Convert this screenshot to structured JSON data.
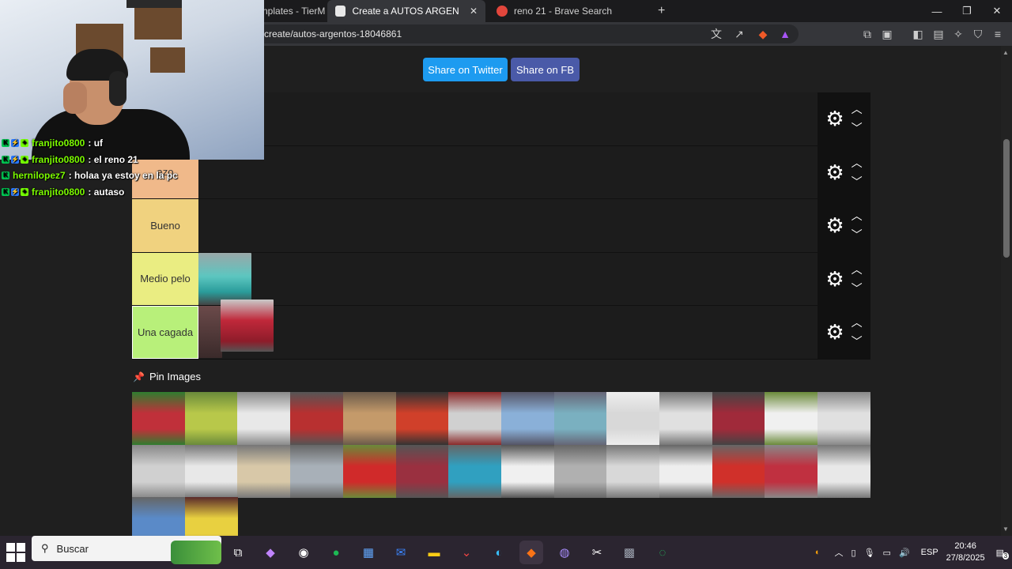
{
  "browser": {
    "tabs": [
      {
        "label": "nplates - TierM",
        "active": false
      },
      {
        "label": "Create a AUTOS ARGENTOS Tier",
        "active": true
      },
      {
        "label": "reno 21 - Brave Search",
        "active": false
      }
    ],
    "new_tab": "+",
    "url": "create/autos-argentos-18046861",
    "window_controls": [
      "minimize",
      "restore",
      "close"
    ]
  },
  "page": {
    "share_twitter": "Share on Twitter",
    "share_fb": "Share on FB",
    "tiers": [
      {
        "label": "",
        "color": "#202020"
      },
      {
        "label": "azo",
        "color": "#f0b98a"
      },
      {
        "label": "Bueno",
        "color": "#f0d27f"
      },
      {
        "label": "Medio pelo",
        "color": "#eaed82"
      },
      {
        "label": "Una cagada",
        "color": "#b8f07a"
      }
    ],
    "pin_images": "Pin Images",
    "pool_count": 30
  },
  "chat": [
    {
      "user": "franjito0800",
      "message": ": uf"
    },
    {
      "user": "franjito0800",
      "message": ": el reno 21"
    },
    {
      "user": "hernilopez7",
      "message": ": holaa ya estoy en la pc"
    },
    {
      "user": "franjito0800",
      "message": ": autaso"
    }
  ],
  "taskbar": {
    "search_placeholder": "Buscar",
    "language": "ESP",
    "time": "20:46",
    "date": "27/8/2025",
    "notification_count": "3"
  }
}
